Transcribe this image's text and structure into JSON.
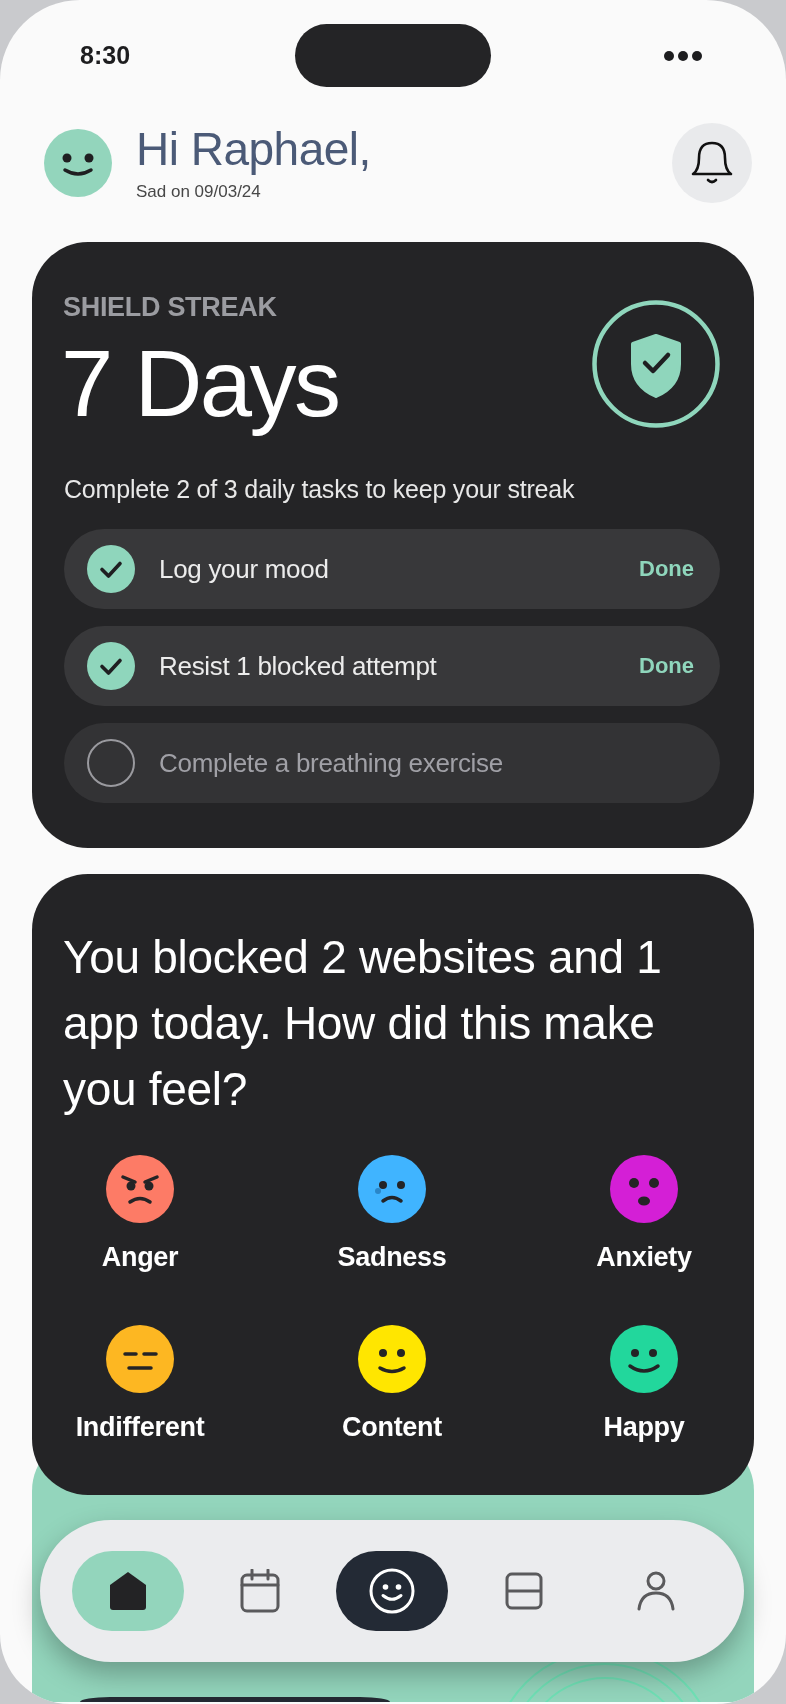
{
  "status_bar": {
    "time": "8:30"
  },
  "header": {
    "greeting": "Hi Raphael,",
    "subtitle": "Sad on 09/03/24"
  },
  "streak": {
    "label": "SHIELD STREAK",
    "value": "7 Days",
    "instruction": "Complete 2 of 3 daily tasks to keep your streak",
    "tasks": [
      {
        "label": "Log your mood",
        "checked": true,
        "status": "Done"
      },
      {
        "label": "Resist 1 blocked attempt",
        "checked": true,
        "status": "Done"
      },
      {
        "label": "Complete a breathing exercise",
        "checked": false
      }
    ]
  },
  "mood_prompt": {
    "question": "You blocked 2 websites and 1 app today. How did this make you feel?",
    "moods": [
      {
        "label": "Anger",
        "kind": "angry",
        "color": "#fd7b66"
      },
      {
        "label": "Sadness",
        "kind": "sad",
        "color": "#40b4ff"
      },
      {
        "label": "Anxiety",
        "kind": "anxious",
        "color": "#d41fd6"
      },
      {
        "label": "Indifferent",
        "kind": "neutral",
        "color": "#fdb722"
      },
      {
        "label": "Content",
        "kind": "content",
        "color": "#ffe600"
      },
      {
        "label": "Happy",
        "kind": "happy",
        "color": "#22d79c"
      }
    ]
  },
  "nav": {
    "items": [
      {
        "kind": "home",
        "selected": true
      },
      {
        "kind": "calendar",
        "selected": false
      },
      {
        "kind": "mood",
        "selected": false
      },
      {
        "kind": "layout",
        "selected": false
      },
      {
        "kind": "profile",
        "selected": false
      }
    ]
  }
}
